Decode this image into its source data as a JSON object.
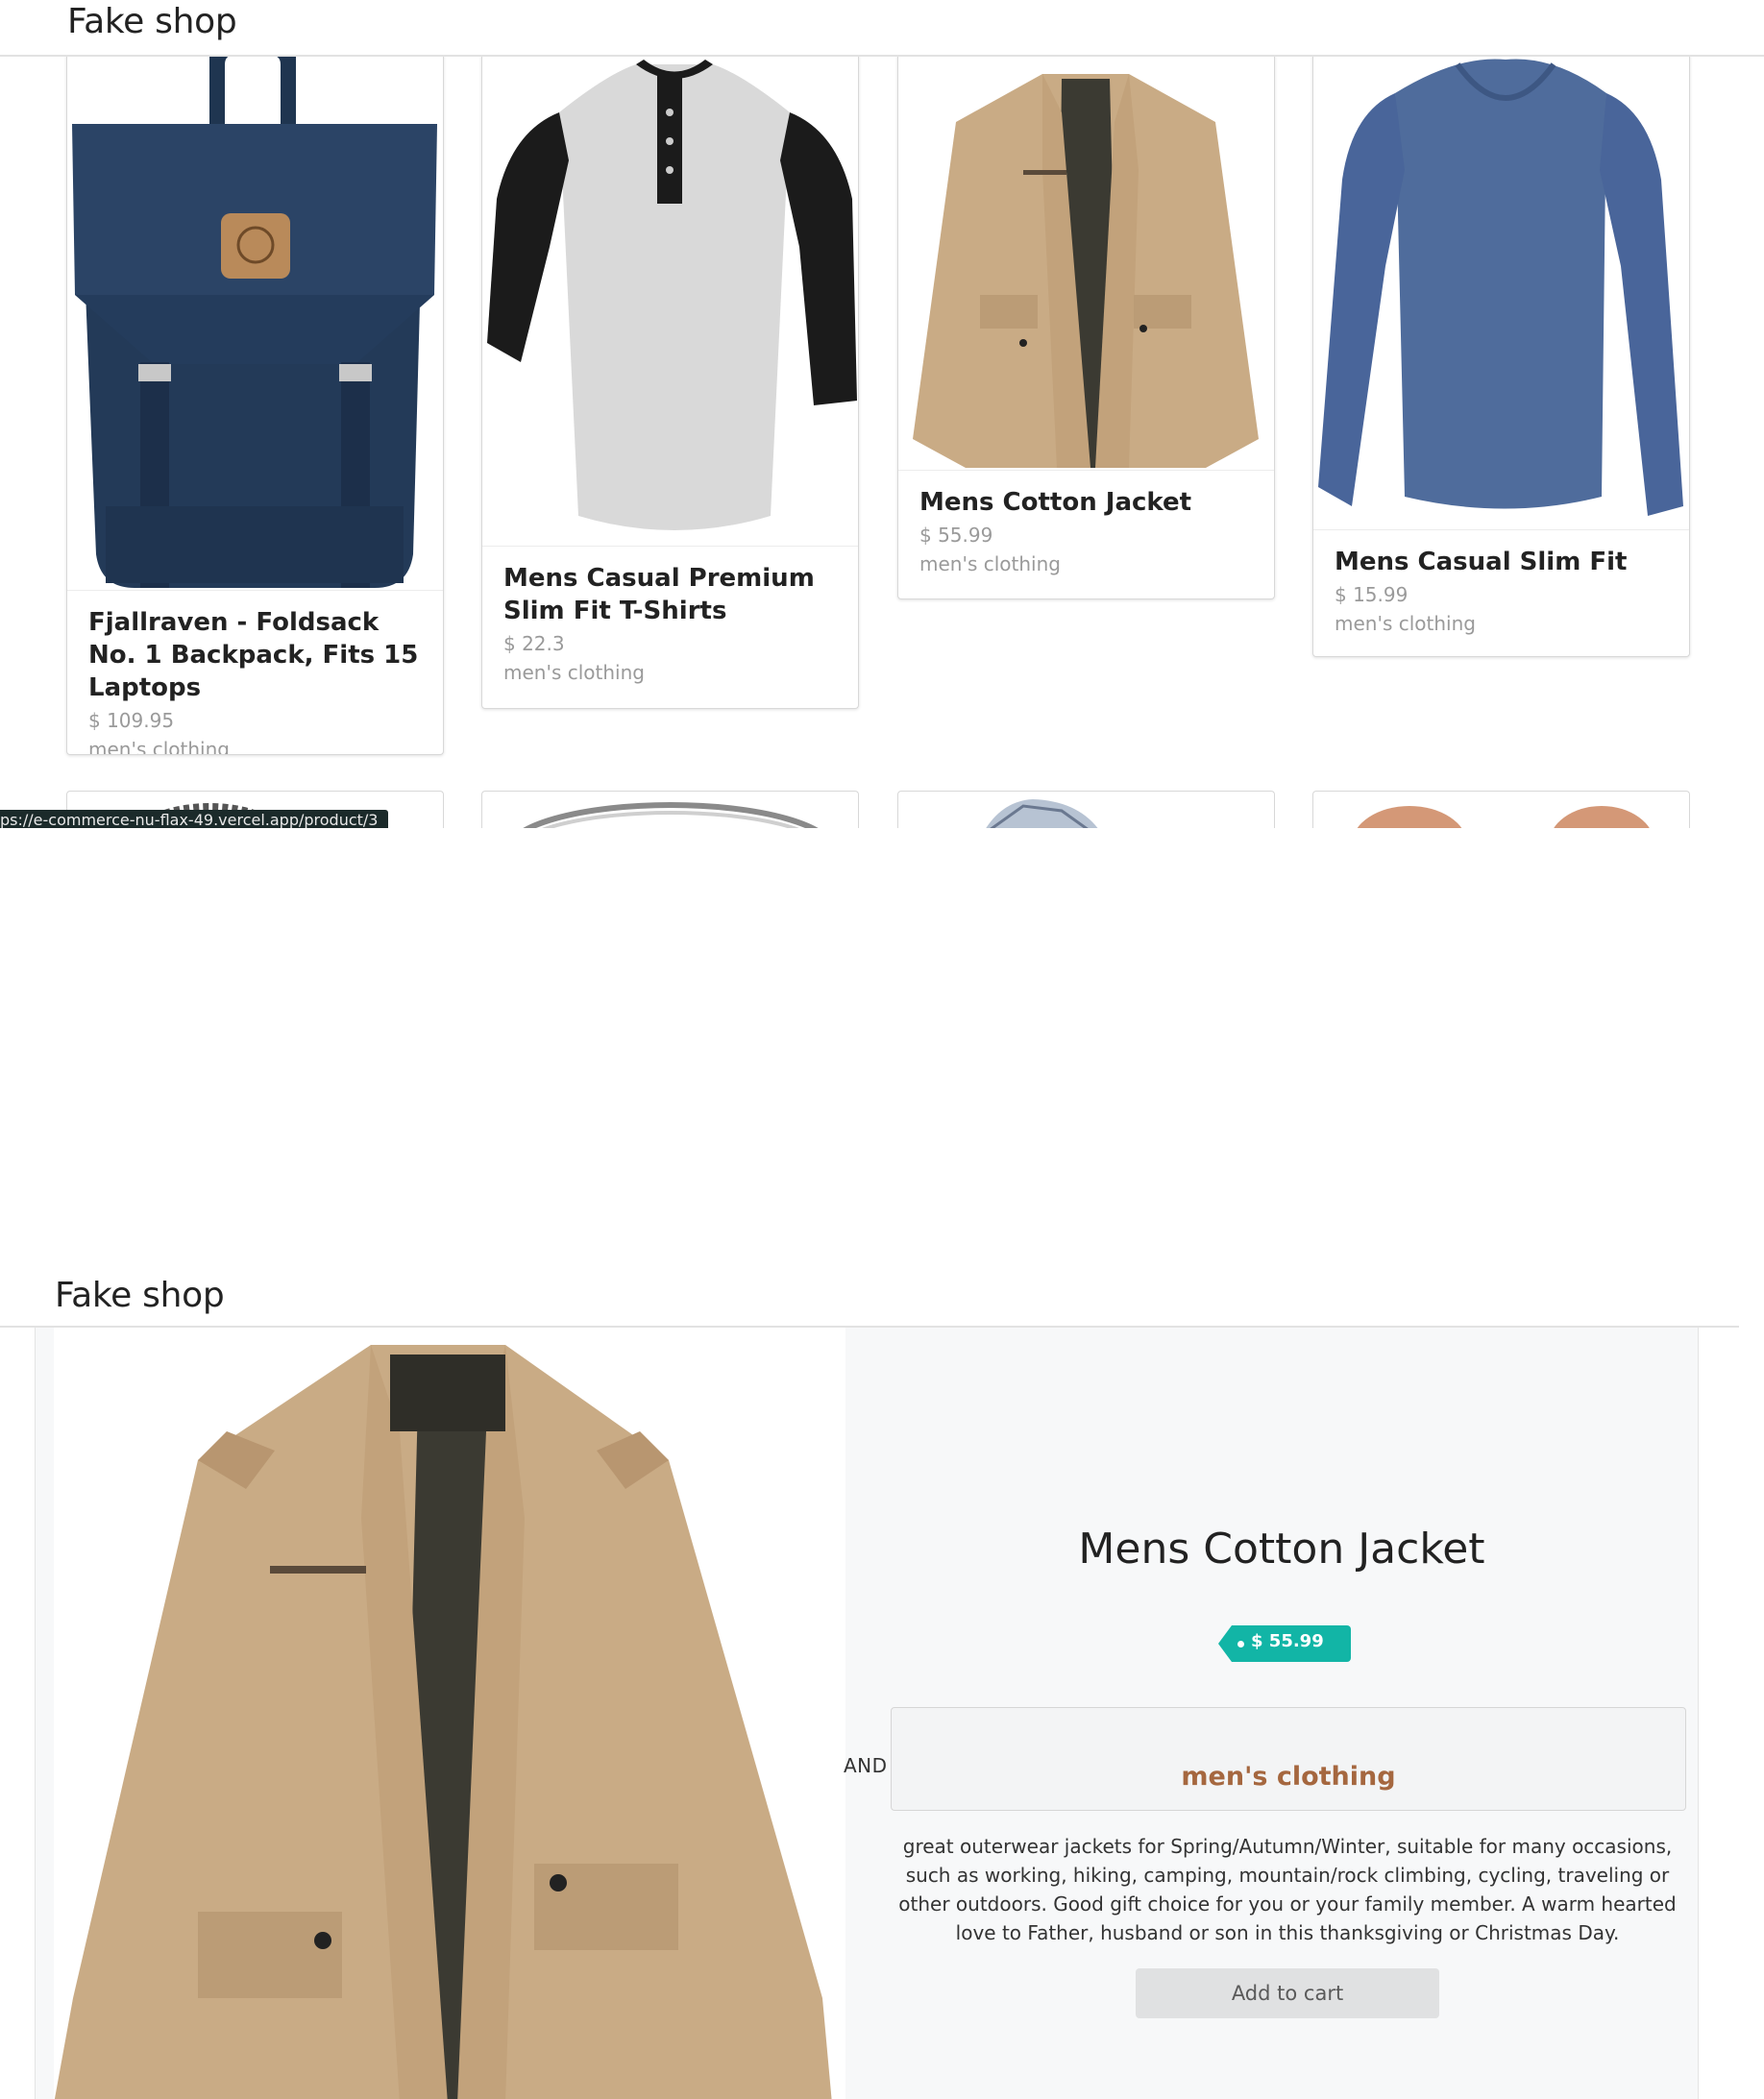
{
  "shop": {
    "brand": "Fake shop"
  },
  "listing": {
    "products": [
      {
        "title": "Fjallraven - Foldsack No. 1 Backpack, Fits 15 Laptops",
        "price": "$ 109.95",
        "category": "men's clothing",
        "image_icon": "backpack-image"
      },
      {
        "title": "Mens Casual Premium Slim Fit T-Shirts",
        "price": "$ 22.3",
        "category": "men's clothing",
        "image_icon": "raglan-tshirt-image"
      },
      {
        "title": "Mens Cotton Jacket",
        "price": "$ 55.99",
        "category": "men's clothing",
        "image_icon": "cotton-jacket-image"
      },
      {
        "title": "Mens Casual Slim Fit",
        "price": "$ 15.99",
        "category": "men's clothing",
        "image_icon": "blue-longsleeve-image"
      }
    ],
    "second_row_icons": [
      "chain-bracelet-image",
      "silver-ring-image",
      "diamond-ring-image",
      "rose-gold-earrings-image"
    ],
    "status_url": "ps://e-commerce-nu-flax-49.vercel.app/product/3"
  },
  "detail": {
    "title": "Mens Cotton Jacket",
    "price": "$ 55.99",
    "divider": "AND",
    "category": "men's clothing",
    "description": "great outerwear jackets for Spring/Autumn/Winter, suitable for many occasions, such as working, hiking, camping, mountain/rock climbing, cycling, traveling or other outdoors. Good gift choice for you or your family member. A warm hearted love to Father, husband or son in this thanksgiving or Christmas Day.",
    "add_to_cart": "Add to cart",
    "image_icon": "cotton-jacket-image"
  },
  "colors": {
    "tag": "#12b5a6",
    "category": "#a5673f",
    "button": "#e0e1e2"
  }
}
